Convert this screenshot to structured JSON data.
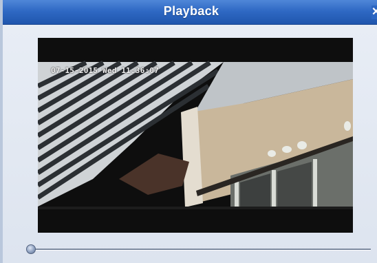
{
  "window": {
    "title": "Playback"
  },
  "close_button": {
    "icon": "close-icon",
    "glyph": "✕"
  },
  "video": {
    "timestamp": "07-15-2015 Wed 11:36:07"
  },
  "playback": {
    "progress_fraction": 0.0
  }
}
